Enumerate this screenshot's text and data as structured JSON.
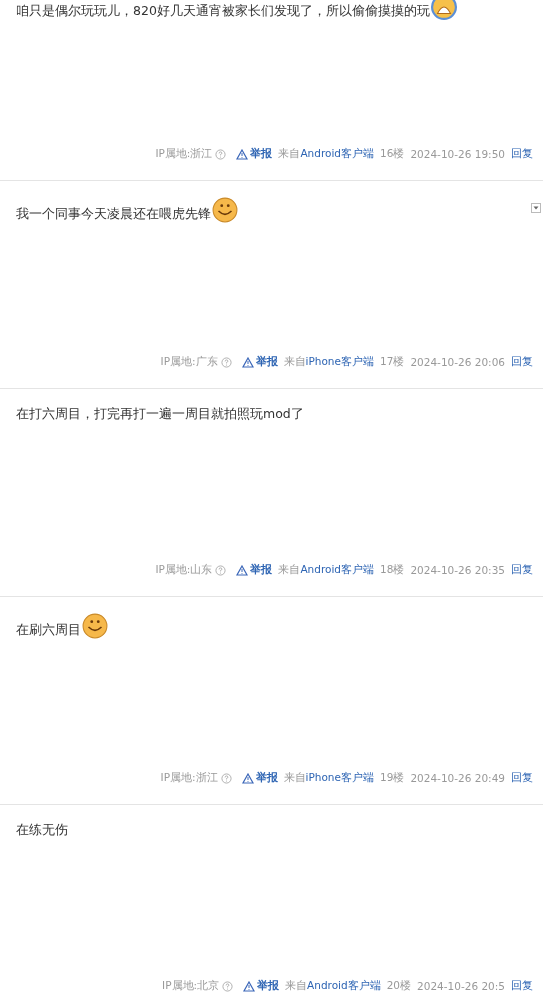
{
  "posts": [
    {
      "text": "咱只是偶尔玩玩儿，820好几天通宵被家长们发现了，所以偷偷摸摸的玩",
      "emoticon": {
        "kind": "cry"
      },
      "has_menu": false,
      "ip": "IP属地:浙江",
      "report": "举报",
      "source_prefix": "来自",
      "source": "Android客户端",
      "floor": "16楼",
      "time": "2024-10-26 19:50",
      "reply": "回复"
    },
    {
      "text": "我一个同事今天凌晨还在喂虎先锋",
      "emoticon": {
        "kind": "smile"
      },
      "has_menu": true,
      "ip": "IP属地:广东",
      "report": "举报",
      "source_prefix": "来自",
      "source": "iPhone客户端",
      "floor": "17楼",
      "time": "2024-10-26 20:06",
      "reply": "回复"
    },
    {
      "text": "在打六周目，打完再打一遍一周目就拍照玩mod了",
      "has_menu": false,
      "ip": "IP属地:山东",
      "report": "举报",
      "source_prefix": "来自",
      "source": "Android客户端",
      "floor": "18楼",
      "time": "2024-10-26 20:35",
      "reply": "回复"
    },
    {
      "text": "在刷六周目",
      "emoticon": {
        "kind": "smile"
      },
      "has_menu": false,
      "ip": "IP属地:浙江",
      "report": "举报",
      "source_prefix": "来自",
      "source": "iPhone客户端",
      "floor": "19楼",
      "time": "2024-10-26 20:49",
      "reply": "回复"
    },
    {
      "text": "在练无伤",
      "has_menu": false,
      "ip": "IP属地:北京",
      "report": "举报",
      "source_prefix": "来自",
      "source": "Android客户端",
      "floor": "20楼",
      "time": "2024-10-26 20:5",
      "reply": "回复"
    }
  ]
}
